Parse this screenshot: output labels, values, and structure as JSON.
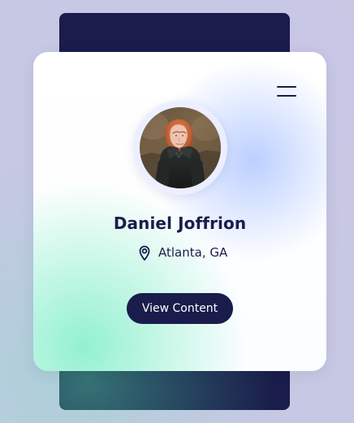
{
  "profile": {
    "name": "Daniel Joffrion",
    "location": "Atlanta, GA",
    "cta_label": "View Content"
  },
  "icons": {
    "menu": "hamburger-menu-icon",
    "location": "map-pin-icon"
  },
  "colors": {
    "navy": "#1A1D4B",
    "background": "#C7C8E3",
    "card": "#FFFFFF",
    "accent_blue": "#B8CDFF",
    "accent_mint": "#8DF0CD",
    "teal_glow": "#377878"
  }
}
